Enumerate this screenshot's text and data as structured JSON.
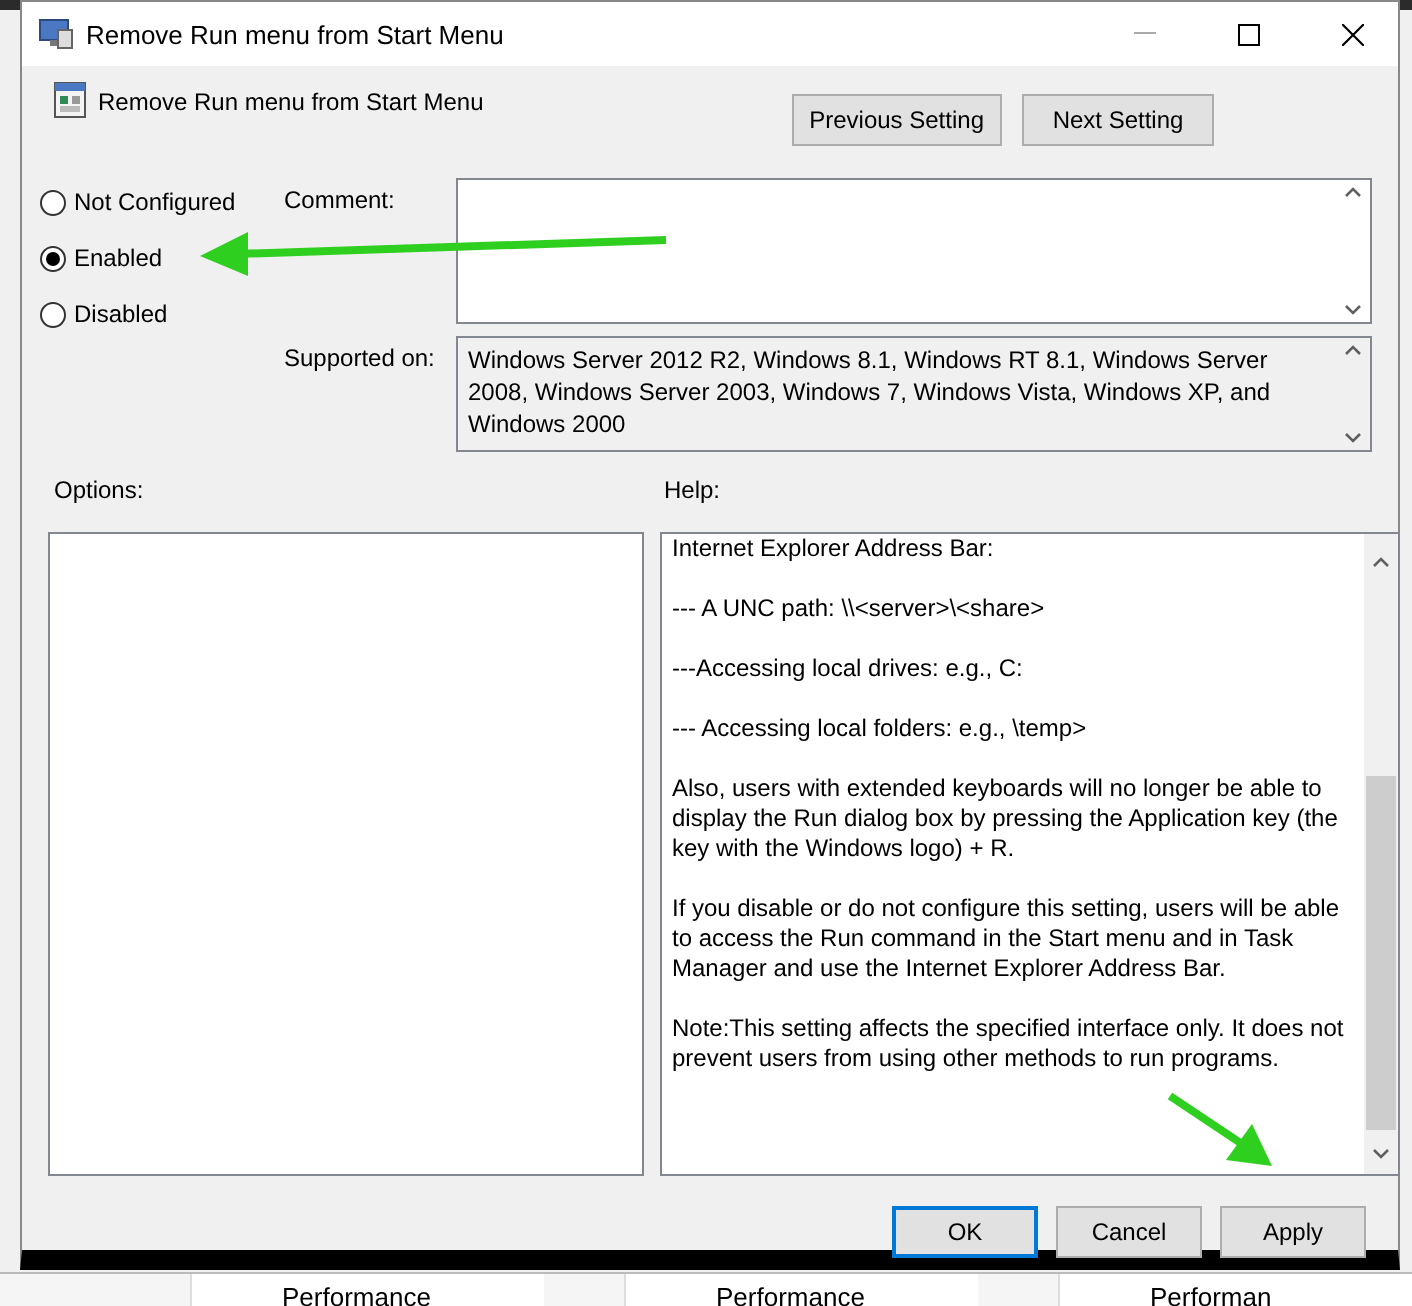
{
  "window": {
    "title": "Remove Run menu from Start Menu"
  },
  "setting_title": "Remove Run menu from Start Menu",
  "nav_buttons": [
    "Previous Setting",
    "Next Setting"
  ],
  "state_options": [
    {
      "label": "Not Configured",
      "selected": false
    },
    {
      "label": "Enabled",
      "selected": true
    },
    {
      "label": "Disabled",
      "selected": false
    }
  ],
  "comment": {
    "label": "Comment:"
  },
  "supported_on": {
    "label": "Supported on:",
    "value": "Windows Server 2012 R2, Windows 8.1, Windows RT 8.1, Windows Server 2008, Windows Server 2003, Windows 7, Windows Vista, Windows XP, and Windows 2000"
  },
  "options": {
    "label": "Options:"
  },
  "help": {
    "label": "Help:",
    "paragraphs": [
      "Internet Explorer Address Bar:",
      "--- A UNC path: \\\\<server>\\<share>",
      "---Accessing local drives:  e.g., C:",
      "--- Accessing local folders: e.g., \\temp>",
      "Also, users with extended keyboards will no longer be able to display the Run dialog box by pressing the Application key (the key with the Windows logo) + R.",
      "If you disable or do not configure this setting, users will be able to access the Run command in the Start menu and in Task Manager and use the Internet Explorer Address Bar.",
      "Note:This setting affects the specified interface only. It does not prevent users from using other methods to run programs."
    ]
  },
  "footer_buttons": [
    {
      "label": "OK",
      "default": true
    },
    {
      "label": "Cancel",
      "default": false
    },
    {
      "label": "Apply",
      "default": false
    }
  ],
  "background": {
    "column_headers": [
      "Performance",
      "Performance",
      "Performan"
    ]
  }
}
